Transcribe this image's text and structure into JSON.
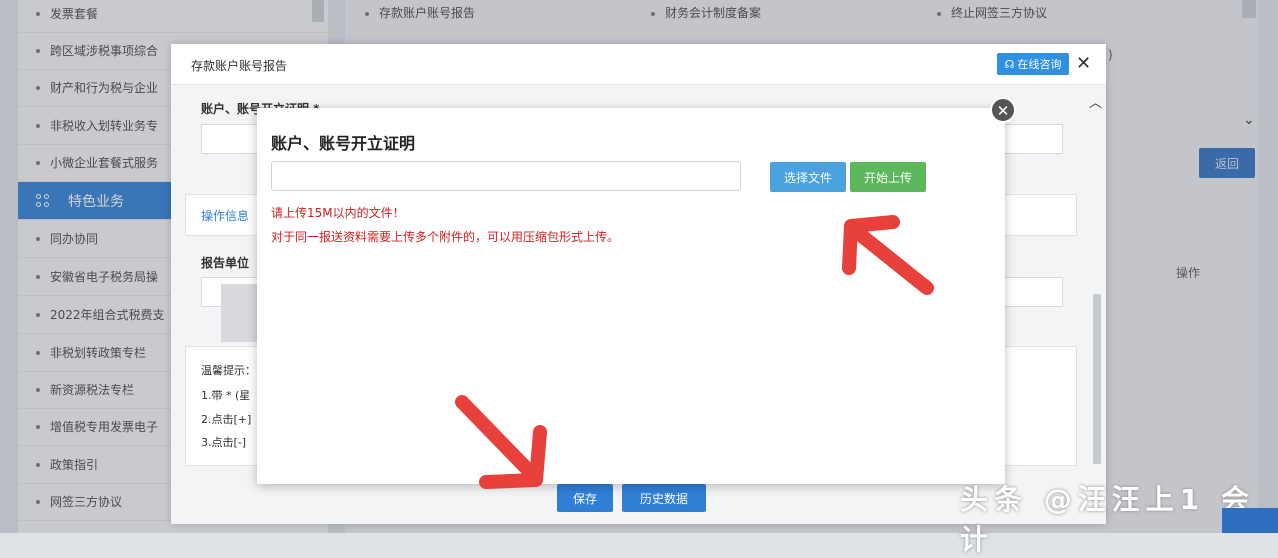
{
  "sidebar": {
    "items": [
      {
        "label": "发票套餐"
      },
      {
        "label": "跨区域涉税事项综合"
      },
      {
        "label": "财产和行为税与企业"
      },
      {
        "label": "非税收入划转业务专"
      },
      {
        "label": "小微企业套餐式服务"
      },
      {
        "label": "特色业务"
      },
      {
        "label": "同办协同"
      },
      {
        "label": "安徽省电子税务局操"
      },
      {
        "label": "2022年组合式税费支"
      },
      {
        "label": "非税划转政策专栏"
      },
      {
        "label": "新资源税法专栏"
      },
      {
        "label": "增值税专用发票电子"
      },
      {
        "label": "政策指引"
      },
      {
        "label": "网签三方协议"
      }
    ]
  },
  "top_links": [
    "存款账户账号报告",
    "财务会计制度备案",
    "终止网签三方协议"
  ],
  "background": {
    "return_label": "返回",
    "operation_col": "操作",
    "paren": ")"
  },
  "dialog": {
    "title": "存款账户账号报告",
    "consult_label": "在线咨询",
    "close_glyph": "✕",
    "field_label": "账户、账号开立证明 *",
    "op_info": "操作信息",
    "report_unit": "报告单位",
    "tip_title": "温馨提示：",
    "tips": [
      "1.带 * (星",
      "2.点击[+]",
      "3.点击[-]"
    ],
    "save_label": "保存",
    "history_label": "历史数据"
  },
  "upload_dialog": {
    "title": "账户、账号开立证明",
    "file_input_value": "",
    "choose_label": "选择文件",
    "upload_label": "开始上传",
    "note1": "请上传15M以内的文件！",
    "note2": "对于同一报送资料需要上传多个附件的，可以用压缩包形式上传。",
    "close_glyph": "✕"
  },
  "watermark": "头条 @汪汪上1 会计",
  "colors": {
    "primary": "#2f7fd6",
    "choose": "#4aa3df",
    "upload": "#5cb85c",
    "warning": "#d21f1f",
    "arrow": "#e8403a"
  }
}
